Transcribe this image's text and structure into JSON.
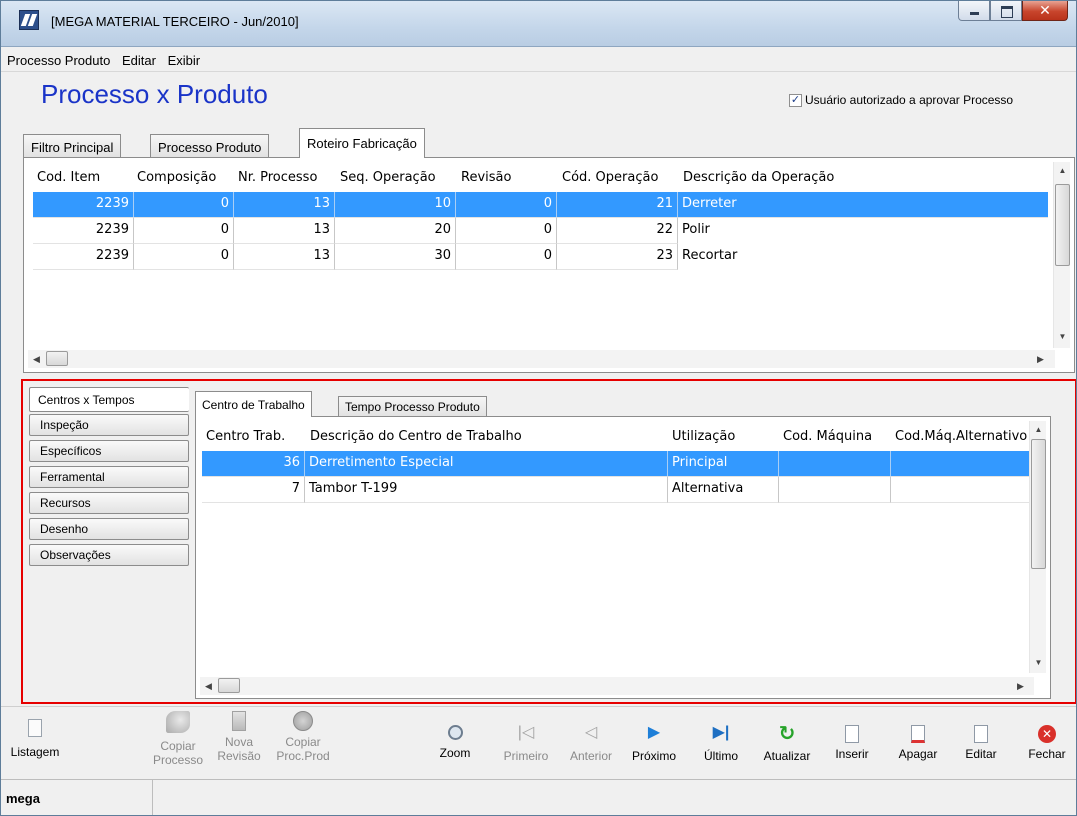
{
  "window": {
    "title": "[MEGA MATERIAL TERCEIRO - Jun/2010]"
  },
  "menu": [
    "Processo Produto",
    "Editar",
    "Exibir"
  ],
  "header": {
    "title": "Processo x Produto",
    "approve_checked": true,
    "approve_label": "Usuário autorizado a aprovar Processo"
  },
  "top_tabs": [
    "Filtro Principal",
    "Processo Produto",
    "Roteiro Fabricação"
  ],
  "top_tabs_active": 2,
  "roteiro": {
    "columns": [
      "Cod. Item",
      "Composição",
      "Nr. Processo",
      "Seq. Operação",
      "Revisão",
      "Cód. Operação",
      "Descrição da Operação"
    ],
    "rows": [
      [
        "2239",
        "0",
        "13",
        "10",
        "0",
        "21",
        "Derreter"
      ],
      [
        "2239",
        "0",
        "13",
        "20",
        "0",
        "22",
        "Polir"
      ],
      [
        "2239",
        "0",
        "13",
        "30",
        "0",
        "23",
        "Recortar"
      ]
    ],
    "selected_row": 0
  },
  "side_tabs": [
    "Centros x Tempos",
    "Inspeção",
    "Específicos",
    "Ferramental",
    "Recursos",
    "Desenho",
    "Observações"
  ],
  "side_tabs_active": 0,
  "inner_tabs": [
    "Centro de Trabalho",
    "Tempo Processo Produto"
  ],
  "inner_tabs_active": 0,
  "centros": {
    "columns": [
      "Centro Trab.",
      "Descrição do Centro de Trabalho",
      "Utilização",
      "Cod. Máquina",
      "Cod.Máq.Alternativo"
    ],
    "rows": [
      [
        "36",
        "Derretimento Especial",
        "Principal",
        "",
        ""
      ],
      [
        "7",
        "Tambor T-199",
        "Alternativa",
        "",
        ""
      ]
    ],
    "selected_row": 0
  },
  "toolbar": {
    "listagem": "Listagem",
    "copiar_processo_1": "Copiar",
    "copiar_processo_2": "Processo",
    "nova_revisao_1": "Nova",
    "nova_revisao_2": "Revisão",
    "copiar_proc_1": "Copiar",
    "copiar_proc_2": "Proc.Prod",
    "zoom": "Zoom",
    "primeiro": "Primeiro",
    "anterior": "Anterior",
    "proximo": "Próximo",
    "ultimo": "Último",
    "atualizar": "Atualizar",
    "inserir": "Inserir",
    "apagar": "Apagar",
    "editar": "Editar",
    "fechar": "Fechar"
  },
  "colors": {
    "selection": "#3399ff",
    "title_blue": "#1a34c8",
    "red_frame": "#e60000"
  },
  "status": {
    "user": "mega"
  }
}
